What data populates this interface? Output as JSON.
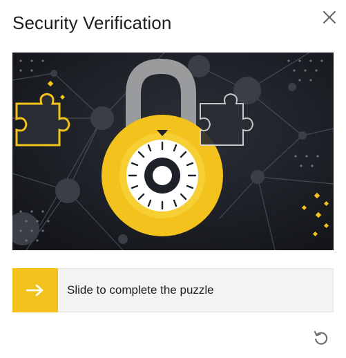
{
  "dialog": {
    "title": "Security Verification"
  },
  "icons": {
    "close": "close-icon",
    "slider_arrow": "arrow-right-icon",
    "refresh": "refresh-icon",
    "puzzle_piece": "puzzle-piece-icon",
    "padlock": "padlock-icon"
  },
  "slider": {
    "label": "Slide to complete the puzzle"
  },
  "colors": {
    "accent": "#f4c21c",
    "image_background": "#1b1e24",
    "track": "#f3f3f3"
  }
}
